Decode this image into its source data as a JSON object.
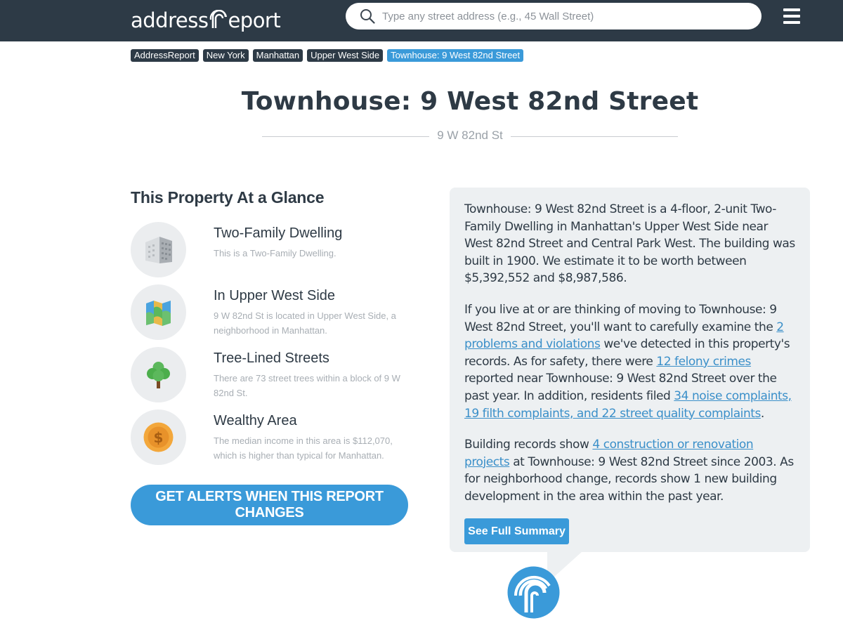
{
  "header": {
    "logo_left": "address",
    "logo_right": "eport",
    "search_placeholder": "Type any street address (e.g., 45 Wall Street)"
  },
  "breadcrumb": [
    "AddressReport",
    "New York",
    "Manhattan",
    "Upper West Side",
    "Townhouse: 9 West 82nd Street"
  ],
  "title": "Townhouse: 9 West 82nd Street",
  "subtitle": "9 W 82nd St",
  "glance": {
    "heading": "This Property At a Glance",
    "features": [
      {
        "icon": "building-icon",
        "title": "Two-Family Dwelling",
        "desc": "This is a Two-Family Dwelling."
      },
      {
        "icon": "map-icon",
        "title": "In Upper West Side",
        "desc": "9 W 82nd St is located in Upper West Side, a neighborhood in Manhattan."
      },
      {
        "icon": "tree-icon",
        "title": "Tree-Lined Streets",
        "desc": "There are 73 street trees within a block of 9 W 82nd St."
      },
      {
        "icon": "dollar-coin-icon",
        "title": "Wealthy Area",
        "desc": "The median income in this area is $112,070, which is higher than typical for Manhattan."
      }
    ],
    "alerts_button": "GET ALERTS WHEN THIS REPORT CHANGES"
  },
  "summary": {
    "p1": "Townhouse: 9 West 82nd Street is a 4-floor, 2-unit Two-Family Dwelling in Manhattan's Upper West Side near West 82nd Street and Central Park West. The building was built in 1900. We estimate it to be worth between $5,392,552 and $8,987,586.",
    "p2_a": "If you live at or are thinking of moving to Townhouse: 9 West 82nd Street, you'll want to carefully examine the ",
    "p2_link1": "2 problems and violations",
    "p2_b": " we've detected in this property's records. As for safety, there were ",
    "p2_link2": "12 felony crimes",
    "p2_c": " reported near Townhouse: 9 West 82nd Street over the past year. In addition, residents filed ",
    "p2_link3": "34 noise complaints, 19 filth complaints, and 22 street quality complaints",
    "p2_d": ".",
    "p3_a": "Building records show ",
    "p3_link": "4 construction or renovation projects",
    "p3_b": " at Townhouse: 9 West 82nd Street since 2003. As for neighborhood change, records show 1 new building development in the area within the past year.",
    "button": "See Full Summary"
  },
  "colors": {
    "header_bg": "#2d3a46",
    "accent": "#3a9ad9",
    "panel_bg": "#edf0f2"
  }
}
